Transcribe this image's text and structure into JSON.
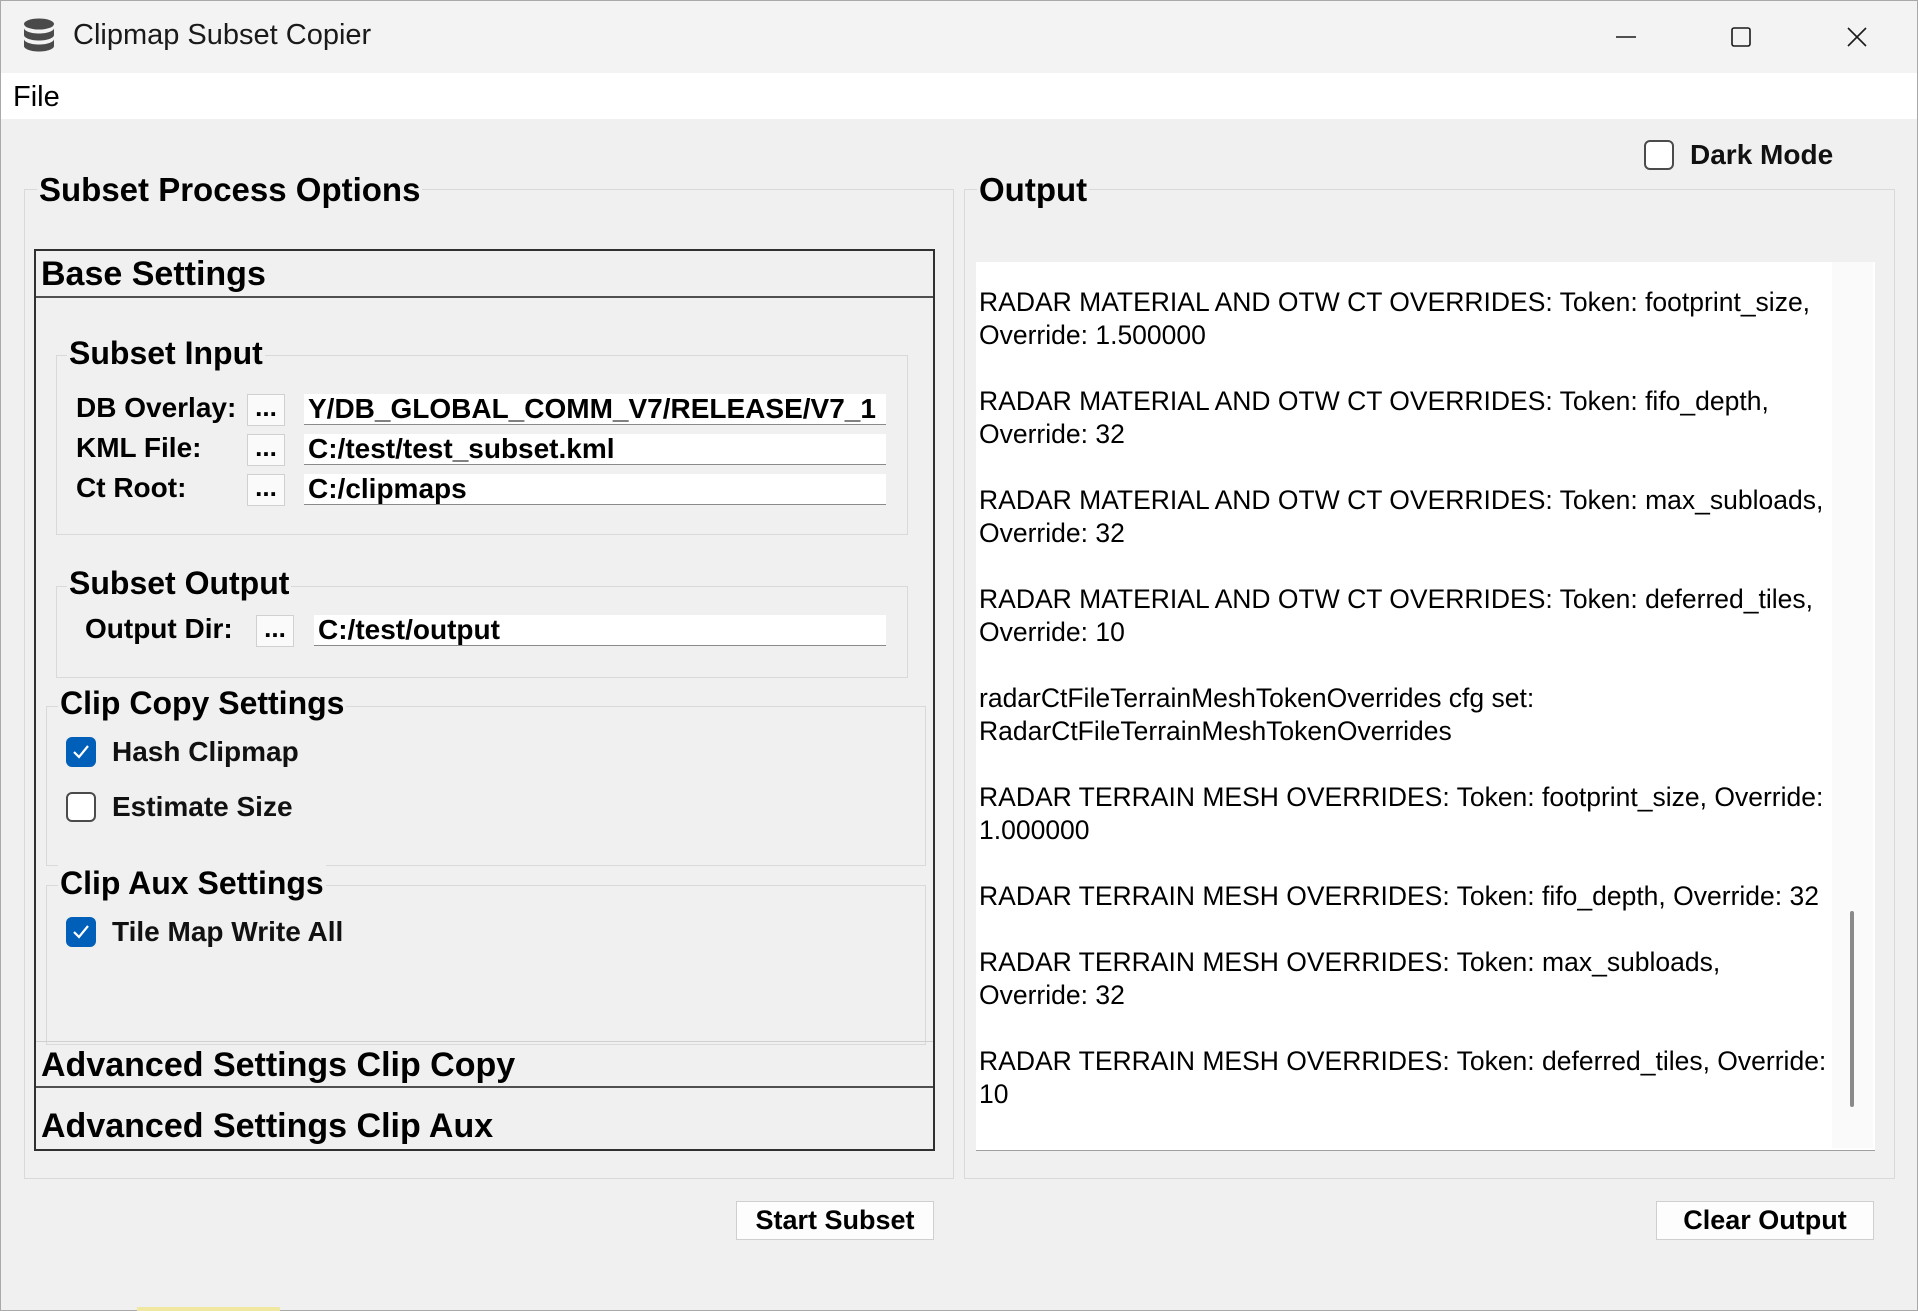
{
  "window": {
    "title": "Clipmap Subset Copier"
  },
  "menu": {
    "file": "File"
  },
  "dark_mode": {
    "label": "Dark Mode",
    "checked": false
  },
  "subset_process": {
    "title": "Subset Process Options",
    "base_settings": {
      "header": "Base Settings",
      "subset_input": {
        "title": "Subset Input",
        "db_overlay": {
          "label": "DB Overlay:",
          "browse": "...",
          "value": "Y/DB_GLOBAL_COMM_V7/RELEASE/V7_1"
        },
        "kml_file": {
          "label": "KML File:",
          "browse": "...",
          "value": "C:/test/test_subset.kml"
        },
        "ct_root": {
          "label": "Ct Root:",
          "browse": "...",
          "value": "C:/clipmaps"
        }
      },
      "subset_output": {
        "title": "Subset Output",
        "output_dir": {
          "label": "Output Dir:",
          "browse": "...",
          "value": "C:/test/output"
        }
      },
      "clip_copy": {
        "title": "Clip Copy Settings",
        "hash_clipmap": {
          "label": "Hash Clipmap",
          "checked": true
        },
        "estimate_size": {
          "label": "Estimate Size",
          "checked": false
        }
      },
      "clip_aux": {
        "title": "Clip Aux Settings",
        "tile_map_write_all": {
          "label": "Tile Map Write All",
          "checked": true
        }
      }
    },
    "advanced_clip_copy": "Advanced Settings Clip Copy",
    "advanced_clip_aux": "Advanced Settings Clip Aux",
    "start_button": "Start Subset"
  },
  "output": {
    "title": "Output",
    "lines": [
      "RADAR MATERIAL AND OTW CT OVERRIDES: Token: footprint_size, Override: 1.500000",
      "RADAR MATERIAL AND OTW CT OVERRIDES: Token: fifo_depth, Override: 32",
      "RADAR MATERIAL AND OTW CT OVERRIDES: Token: max_subloads, Override: 32",
      "RADAR MATERIAL AND OTW CT OVERRIDES: Token: deferred_tiles, Override: 10",
      "radarCtFileTerrainMeshTokenOverrides cfg set: RadarCtFileTerrainMeshTokenOverrides",
      "RADAR TERRAIN MESH OVERRIDES: Token: footprint_size, Override: 1.000000",
      "RADAR TERRAIN MESH OVERRIDES: Token: fifo_depth, Override: 32",
      "RADAR TERRAIN MESH OVERRIDES: Token: max_subloads, Override: 32",
      "RADAR TERRAIN MESH OVERRIDES: Token: deferred_tiles, Override: 10"
    ],
    "clear_button": "Clear Output"
  },
  "colors": {
    "accent": "#005fb8",
    "window_bg": "#f0f0f0",
    "titlebar_bg": "#f3f3f3"
  },
  "icons": [
    "database-icon",
    "minimize-icon",
    "maximize-icon",
    "close-icon",
    "checkmark-icon"
  ]
}
